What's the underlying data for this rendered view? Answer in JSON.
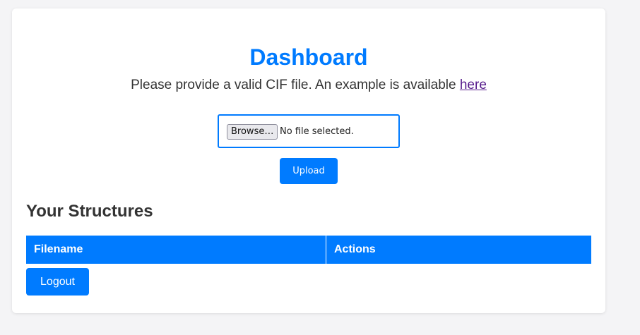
{
  "page": {
    "title": "Dashboard",
    "intro_text": "Please provide a valid CIF file. An example is available ",
    "intro_link": "here"
  },
  "upload": {
    "browse_label": "Browse…",
    "file_status": "No file selected.",
    "upload_label": "Upload"
  },
  "structures": {
    "heading": "Your Structures",
    "columns": [
      "Filename",
      "Actions"
    ],
    "rows": []
  },
  "logout_label": "Logout",
  "colors": {
    "accent": "#007bff",
    "link_visited": "#551a8b",
    "background": "#f4f4f6"
  }
}
